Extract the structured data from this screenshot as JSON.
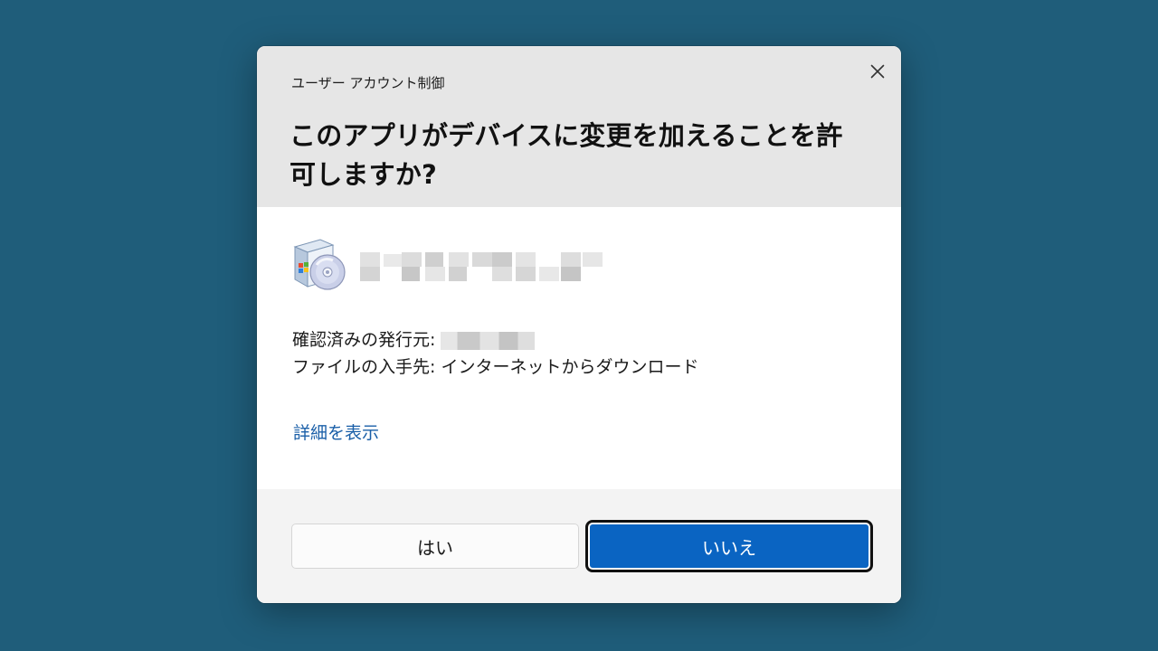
{
  "dialog": {
    "window_title": "ユーザー アカウント制御",
    "question": "このアプリがデバイスに変更を加えることを許可しますか?",
    "app": {
      "icon": "software-installer-icon"
    },
    "publisher_label": "確認済みの発行元:",
    "origin_label": "ファイルの入手先: インターネットからダウンロード",
    "details_link": "詳細を表示",
    "buttons": {
      "yes_label": "はい",
      "no_label": "いいえ"
    },
    "close_icon": "close-icon"
  },
  "colors": {
    "desktop_background": "#1f5d7a",
    "header_background": "#e6e6e6",
    "footer_background": "#f3f3f3",
    "link": "#1a5fa8",
    "primary_button": "#0a64c2"
  }
}
